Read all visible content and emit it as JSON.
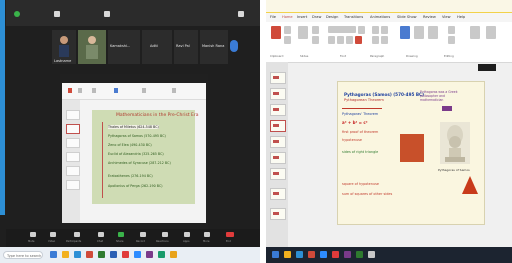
{
  "zoom": {
    "participants": [
      {
        "name": "Lastname"
      },
      {
        "name": ""
      },
      {
        "name": "Kamakshi..."
      },
      {
        "name": "Aditi"
      },
      {
        "name": "Ravi Pal"
      },
      {
        "name": "Manish Rana"
      }
    ],
    "slide": {
      "heading": "Mathematicians in the Pre-Christ Era",
      "bullets": [
        "Thales of Miletus (624-548 BC)",
        "Pythagoras of Samos (570-495 BC)",
        "Zeno of Elea (490-430 BC)",
        "Euclid of Alexandria (325-265 BC)",
        "Archimedes of Syracuse (287-212 BC)",
        "Eratosthenes (276-194 BC)",
        "Apollonius of Perga (262-190 BC)"
      ]
    },
    "controls": [
      "Mute",
      "Video",
      "Participants",
      "Chat",
      "Share",
      "Record",
      "Reactions",
      "Apps",
      "More",
      "End"
    ],
    "taskbar": {
      "search_placeholder": "Type here to search"
    }
  },
  "powerpoint": {
    "menu": [
      "File",
      "Home",
      "Insert",
      "Draw",
      "Design",
      "Transitions",
      "Animations",
      "Slide Show",
      "Review",
      "View",
      "Help"
    ],
    "ribbon_groups": [
      "Clipboard",
      "Slides",
      "Font",
      "Paragraph",
      "Drawing",
      "Editing"
    ],
    "slide": {
      "title_line1": "Pythagoras (Samos) (570-495 BC)",
      "title_line2": "Pythagorean Theorem",
      "lines": [
        "Pythagoras' Theorem",
        "a² + b² = c²",
        "first proof of theorem",
        "hypotenuse",
        "sides of right triangle",
        "square of hypotenuse",
        "sum of squares of other sides"
      ],
      "note": "Pythagoras was a Greek philosopher and mathematician",
      "caption": "Pythagoras of Samos"
    }
  },
  "colors": {
    "zoom_bg": "#1f1f1f",
    "slide_green": "#cfdcb4",
    "ppt_red": "#c0504d",
    "slide_cream": "#faf6e0"
  }
}
